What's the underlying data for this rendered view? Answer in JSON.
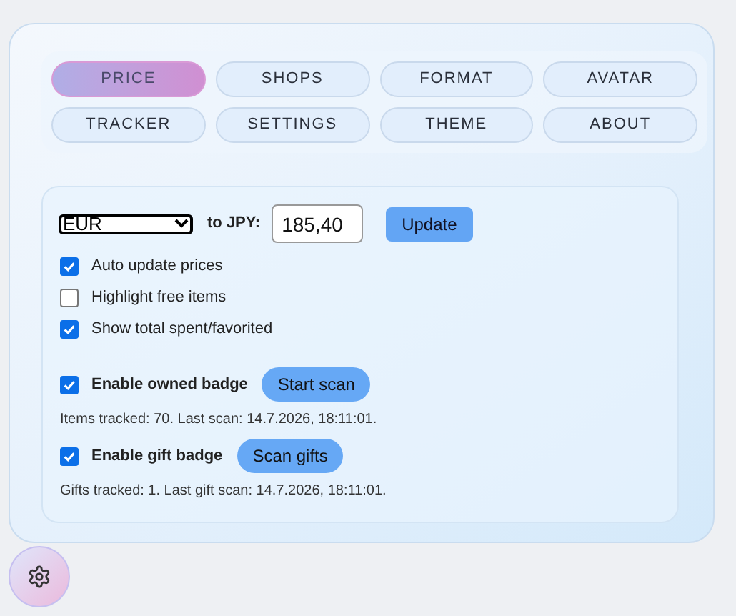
{
  "tabs": [
    {
      "label": "PRICE",
      "selected": true
    },
    {
      "label": "SHOPS",
      "selected": false
    },
    {
      "label": "FORMAT",
      "selected": false
    },
    {
      "label": "AVATAR",
      "selected": false
    },
    {
      "label": "TRACKER",
      "selected": false
    },
    {
      "label": "SETTINGS",
      "selected": false
    },
    {
      "label": "THEME",
      "selected": false
    },
    {
      "label": "ABOUT",
      "selected": false
    }
  ],
  "currency": {
    "value": "EUR",
    "label": "to JPY:",
    "rate": "185,40",
    "button": "Update"
  },
  "options": [
    {
      "label": "Auto update prices",
      "checked": true
    },
    {
      "label": "Highlight free items",
      "checked": false
    },
    {
      "label": "Show total spent/favorited",
      "checked": true
    }
  ],
  "badges": [
    {
      "label": "Enable owned badge",
      "checked": true,
      "button": "Start scan",
      "status": "Items tracked: 70. Last scan: 14.7.2026, 18:11:01."
    },
    {
      "label": "Enable gift badge",
      "checked": true,
      "button": "Scan gifts",
      "status": "Gifts tracked: 1. Last gift scan: 14.7.2026, 18:11:01."
    }
  ]
}
